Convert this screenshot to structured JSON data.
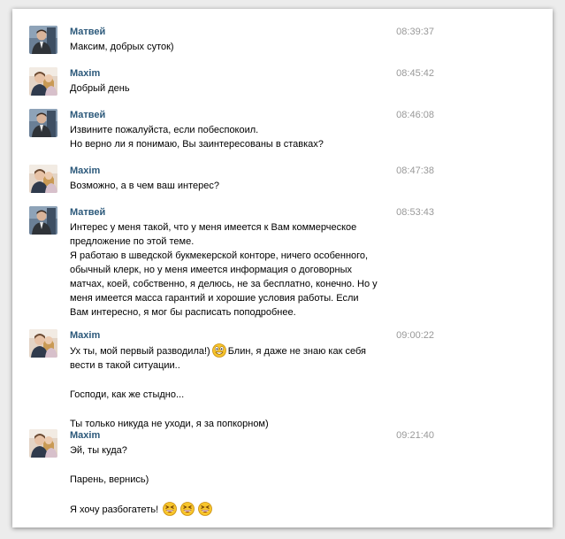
{
  "messages": [
    {
      "author": "Матвей",
      "avatar": "matvey",
      "time": "08:39:37",
      "lines": [
        "Максим, добрых суток)"
      ]
    },
    {
      "author": "Maxim",
      "avatar": "maxim",
      "time": "08:45:42",
      "lines": [
        "Добрый день"
      ]
    },
    {
      "author": "Матвей",
      "avatar": "matvey",
      "time": "08:46:08",
      "lines": [
        "Извините пожалуйста, если побеспокоил.",
        "Но верно ли я понимаю, Вы заинтересованы в ставках?"
      ]
    },
    {
      "author": "Maxim",
      "avatar": "maxim",
      "time": "08:47:38",
      "lines": [
        "Возможно, а в чем ваш интерес?"
      ]
    },
    {
      "author": "Матвей",
      "avatar": "matvey",
      "time": "08:53:43",
      "lines": [
        "Интерес у меня такой, что у меня имеется к Вам коммерческое",
        "предложение по этой теме.",
        "Я работаю в шведской букмекерской конторе, ничего особенного,",
        "обычный клерк, но у меня имеется информация о договорных",
        "матчах, коей, собственно, я делюсь, не за бесплатно, конечно. Но у",
        "меня имеется масса гарантий и хорошие условия работы. Если",
        "Вам интересно, я мог бы расписать поподробнее."
      ]
    },
    {
      "author": "Maxim",
      "avatar": "maxim",
      "time": "09:00:22",
      "lines_a1": "Ух ты, мой первый разводила!)",
      "lines_a2": "Блин, я даже не знаю как себя",
      "lines_a3": "вести в такой ситуации..",
      "line_b": "Господи, как же стыдно...",
      "line_c": "Ты только никуда не уходи, я за попкорном)"
    },
    {
      "author": "Maxim",
      "avatar": "maxim",
      "time": "09:21:40",
      "line_a": "Эй, ты куда?",
      "line_b": "Парень, вернись)",
      "line_c": "Я хочу разбогатеть!"
    }
  ],
  "icons": {
    "emoji_surprised": "grinning-shocked-emoji",
    "emoji_laugh": "laughing-squint-emoji"
  },
  "colors": {
    "author": "#2b587a",
    "time": "#999999",
    "text": "#000000"
  }
}
